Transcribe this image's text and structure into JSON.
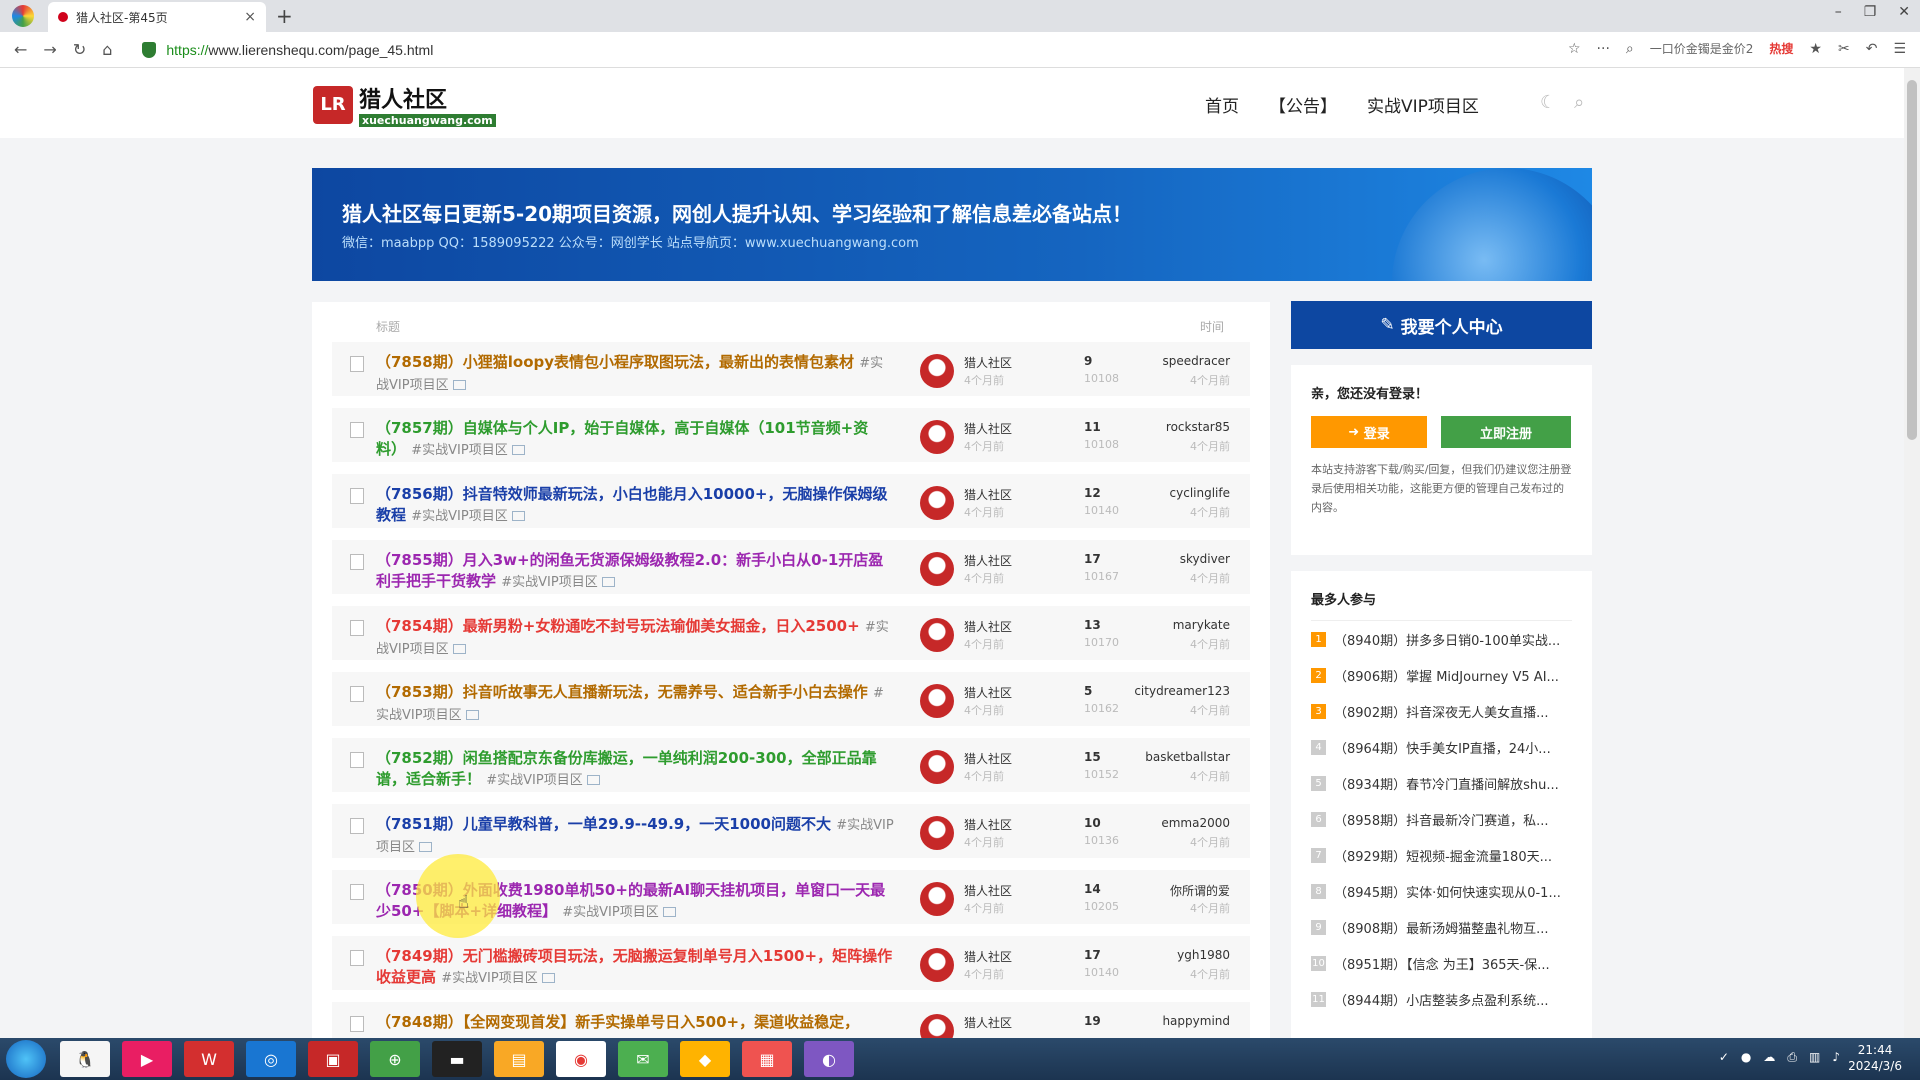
{
  "browser": {
    "tab_title": "猎人社区-第45页",
    "url_scheme": "https://",
    "url_rest": "www.lierenshequ.com/page_45.html",
    "search_hint": "一口价金镯是金价2",
    "hot_label": "热搜"
  },
  "header": {
    "logo_mark": "LR",
    "logo_title": "猎人社区",
    "logo_sub": "xuechuangwang.com",
    "nav": [
      "首页",
      "【公告】",
      "实战VIP项目区"
    ]
  },
  "banner": {
    "title": "猎人社区每日更新5-20期项目资源，网创人提升认知、学习经验和了解信息差必备站点！",
    "sub": "微信：maabpp QQ：1589095222 公众号：网创学长 站点导航页：www.xuechuangwang.com"
  },
  "list": {
    "head_title": "标题",
    "head_time": "时间",
    "rows": [
      {
        "title": "（7858期）小狸猫loopy表情包小程序取图玩法，最新出的表情包素材",
        "tag": "#实战VIP项目区",
        "color": "#b26a00",
        "author": "猎人社区",
        "author_time": "4个月前",
        "count": "9",
        "views": "10108",
        "replier": "speedracer",
        "rep_time": "4个月前"
      },
      {
        "title": "（7857期）自媒体与个人IP，始于自媒体，高于自媒体（101节音频+资料）",
        "tag": "#实战VIP项目区",
        "color": "#2e9c2e",
        "author": "猎人社区",
        "author_time": "4个月前",
        "count": "11",
        "views": "10108",
        "replier": "rockstar85",
        "rep_time": "4个月前"
      },
      {
        "title": "（7856期）抖音特效师最新玩法，小白也能月入10000+，无脑操作保姆级教程",
        "tag": "#实战VIP项目区",
        "color": "#1a3fa8",
        "author": "猎人社区",
        "author_time": "4个月前",
        "count": "12",
        "views": "10140",
        "replier": "cyclinglife",
        "rep_time": "4个月前"
      },
      {
        "title": "（7855期）月入3w+的闲鱼无货源保姆级教程2.0：新手小白从0-1开店盈利手把手干货教学",
        "tag": "#实战VIP项目区",
        "color": "#9c27b0",
        "author": "猎人社区",
        "author_time": "4个月前",
        "count": "17",
        "views": "10167",
        "replier": "skydiver",
        "rep_time": "4个月前"
      },
      {
        "title": "（7854期）最新男粉+女粉通吃不封号玩法瑜伽美女掘金，日入2500+",
        "tag": "#实战VIP项目区",
        "color": "#e53935",
        "author": "猎人社区",
        "author_time": "4个月前",
        "count": "13",
        "views": "10170",
        "replier": "marykate",
        "rep_time": "4个月前"
      },
      {
        "title": "（7853期）抖音听故事无人直播新玩法，无需养号、适合新手小白去操作",
        "tag": "#实战VIP项目区",
        "color": "#b26a00",
        "author": "猎人社区",
        "author_time": "4个月前",
        "count": "5",
        "views": "10162",
        "replier": "citydreamer123",
        "rep_time": "4个月前"
      },
      {
        "title": "（7852期）闲鱼搭配京东备份库搬运，一单纯利润200-300，全部正品靠谱，适合新手！",
        "tag": "#实战VIP项目区",
        "color": "#2e9c2e",
        "author": "猎人社区",
        "author_time": "4个月前",
        "count": "15",
        "views": "10152",
        "replier": "basketballstar",
        "rep_time": "4个月前"
      },
      {
        "title": "（7851期）儿童早教科普，一单29.9--49.9，一天1000问题不大",
        "tag": "#实战VIP项目区",
        "color": "#1a3fa8",
        "author": "猎人社区",
        "author_time": "4个月前",
        "count": "10",
        "views": "10136",
        "replier": "emma2000",
        "rep_time": "4个月前"
      },
      {
        "title": "（7850期）外面收费1980单机50+的最新AI聊天挂机项目，单窗口一天最少50+【脚本+详细教程】",
        "tag": "#实战VIP项目区",
        "color": "#9c27b0",
        "author": "猎人社区",
        "author_time": "4个月前",
        "count": "14",
        "views": "10205",
        "replier": "你所谓的爱",
        "rep_time": "4个月前"
      },
      {
        "title": "（7849期）无门槛搬砖项目玩法，无脑搬运复制单号月入1500+，矩阵操作收益更高",
        "tag": "#实战VIP项目区",
        "color": "#e53935",
        "author": "猎人社区",
        "author_time": "4个月前",
        "count": "17",
        "views": "10140",
        "replier": "ygh1980",
        "rep_time": "4个月前"
      },
      {
        "title": "（7848期）【全网变现首发】新手实操单号日入500+，渠道收益稳定，",
        "tag": "",
        "color": "#b26a00",
        "author": "猎人社区",
        "author_time": "",
        "count": "19",
        "views": "",
        "replier": "happymind",
        "rep_time": ""
      }
    ]
  },
  "sidebar": {
    "vip_label": "我要个人中心",
    "hello": "亲，您还没有登录！",
    "login_label": "登录",
    "register_label": "立即注册",
    "note": "本站支持游客下载/购买/回复，但我们仍建议您注册登录后使用相关功能，这能更方便的管理自己发布过的内容。",
    "hot_title": "最多人参与",
    "hot_items": [
      {
        "rank": "1",
        "text": "（8940期）拼多多日销0-100单实战...",
        "color": "#ff9800"
      },
      {
        "rank": "2",
        "text": "（8906期）掌握 MidJourney V5 AI...",
        "color": "#ff9800"
      },
      {
        "rank": "3",
        "text": "（8902期）抖音深夜无人美女直播...",
        "color": "#ff9800"
      },
      {
        "rank": "4",
        "text": "（8964期）快手美女IP直播，24小...",
        "color": "#ccc"
      },
      {
        "rank": "5",
        "text": "（8934期）春节冷门直播间解放shu...",
        "color": "#ccc"
      },
      {
        "rank": "6",
        "text": "（8958期）抖音最新冷门赛道，私...",
        "color": "#ccc"
      },
      {
        "rank": "7",
        "text": "（8929期）短视频-掘金流量180天...",
        "color": "#ccc"
      },
      {
        "rank": "8",
        "text": "（8945期）实体·如何快速实现从0-1...",
        "color": "#ccc"
      },
      {
        "rank": "9",
        "text": "（8908期）最新汤姆猫整蛊礼物互...",
        "color": "#ccc"
      },
      {
        "rank": "10",
        "text": "（8951期）【信念 为王】365天-保...",
        "color": "#ccc"
      },
      {
        "rank": "11",
        "text": "（8944期）小店整装多点盈利系统...",
        "color": "#ccc"
      }
    ]
  },
  "taskbar": {
    "time": "21:44",
    "date": "2024/3/6"
  }
}
